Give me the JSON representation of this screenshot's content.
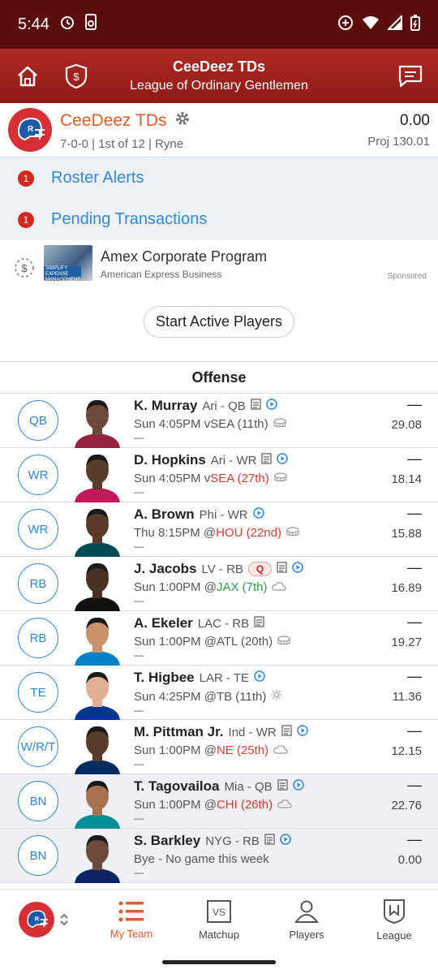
{
  "status": {
    "time": "5:44"
  },
  "header": {
    "title": "CeeDeez TDs",
    "subtitle": "League of Ordinary Gentlemen"
  },
  "team": {
    "name": "CeeDeez TDs",
    "record": "7-0-0 | 1st of 12 | Ryne",
    "points": "0.00",
    "proj": "Proj 130.01"
  },
  "alerts": [
    {
      "count": "1",
      "label": "Roster Alerts"
    },
    {
      "count": "1",
      "label": "Pending Transactions"
    }
  ],
  "ad": {
    "icon_text": "$",
    "thumb_text": "SIMPLIFY EXPENSE MANAGEMENT",
    "title": "Amex Corporate Program",
    "sub": "American Express Business",
    "sponsored": "Sponsored"
  },
  "start_button": "Start Active Players",
  "section": "Offense",
  "players": [
    {
      "pos": "QB",
      "name": "K. Murray",
      "team": "Ari - QB",
      "badge": "",
      "time": "Sun 4:05PM v",
      "opp": "SEA (11th)",
      "opp_class": "",
      "dash_top": "—",
      "dash_bottom": "—",
      "proj": "29.08",
      "skin": "#6b4a3a",
      "jersey": "#97233f",
      "bench": false
    },
    {
      "pos": "WR",
      "name": "D. Hopkins",
      "team": "Ari - WR",
      "badge": "",
      "time": "Sun 4:05PM v",
      "opp": "SEA (27th)",
      "opp_class": "bad",
      "dash_top": "—",
      "dash_bottom": "—",
      "proj": "18.14",
      "skin": "#5a3b2c",
      "jersey": "#c2185b",
      "bench": false
    },
    {
      "pos": "WR",
      "name": "A. Brown",
      "team": "Phi - WR",
      "badge": "",
      "time": "Thu 8:15PM @",
      "opp": "HOU (22nd)",
      "opp_class": "bad",
      "dash_top": "—",
      "dash_bottom": "—",
      "proj": "15.88",
      "skin": "#5b3a2a",
      "jersey": "#004c54",
      "bench": false
    },
    {
      "pos": "RB",
      "name": "J. Jacobs",
      "team": "LV - RB",
      "badge": "Q",
      "time": "Sun 1:00PM @",
      "opp": "JAX (7th)",
      "opp_class": "good",
      "dash_top": "—",
      "dash_bottom": "—",
      "proj": "16.89",
      "skin": "#4a3023",
      "jersey": "#111111",
      "bench": false
    },
    {
      "pos": "RB",
      "name": "A. Ekeler",
      "team": "LAC - RB",
      "badge": "",
      "time": "Sun 1:00PM @",
      "opp": "ATL (20th)",
      "opp_class": "",
      "dash_top": "—",
      "dash_bottom": "—",
      "proj": "19.27",
      "skin": "#c9926a",
      "jersey": "#0080c6",
      "bench": false
    },
    {
      "pos": "TE",
      "name": "T. Higbee",
      "team": "LAR - TE",
      "badge": "",
      "time": "Sun 4:25PM @",
      "opp": "TB (11th)",
      "opp_class": "",
      "dash_top": "—",
      "dash_bottom": "—",
      "proj": "11.36",
      "skin": "#e0b094",
      "jersey": "#003594",
      "bench": false
    },
    {
      "pos": "W/R/T",
      "name": "M. Pittman Jr.",
      "team": "Ind - WR",
      "badge": "",
      "time": "Sun 1:00PM @",
      "opp": "NE (25th)",
      "opp_class": "bad",
      "dash_top": "—",
      "dash_bottom": "—",
      "proj": "12.15",
      "skin": "#5a3a2a",
      "jersey": "#002c5f",
      "bench": false
    },
    {
      "pos": "BN",
      "name": "T. Tagovailoa",
      "team": "Mia - QB",
      "badge": "",
      "time": "Sun 1:00PM @",
      "opp": "CHI (26th)",
      "opp_class": "bad",
      "dash_top": "—",
      "dash_bottom": "—",
      "proj": "22.76",
      "skin": "#a8714f",
      "jersey": "#008e97",
      "bench": true
    },
    {
      "pos": "BN",
      "name": "S. Barkley",
      "team": "NYG - RB",
      "badge": "",
      "time": "Bye - No game this week",
      "opp": "",
      "opp_class": "",
      "dash_top": "—",
      "dash_bottom": "—",
      "proj": "0.00",
      "skin": "#6b4a3a",
      "jersey": "#0b2265",
      "bench": true
    }
  ],
  "tabs": [
    {
      "label": "My Team",
      "icon": "list-icon",
      "active": true
    },
    {
      "label": "Matchup",
      "icon": "vs-icon",
      "active": false
    },
    {
      "label": "Players",
      "icon": "person-icon",
      "active": false
    },
    {
      "label": "League",
      "icon": "shield-icon",
      "active": false
    }
  ],
  "colors": {
    "accent": "#e05c2a",
    "link": "#2e86de",
    "header": "#a3221d",
    "alert": "#d42a1e"
  }
}
